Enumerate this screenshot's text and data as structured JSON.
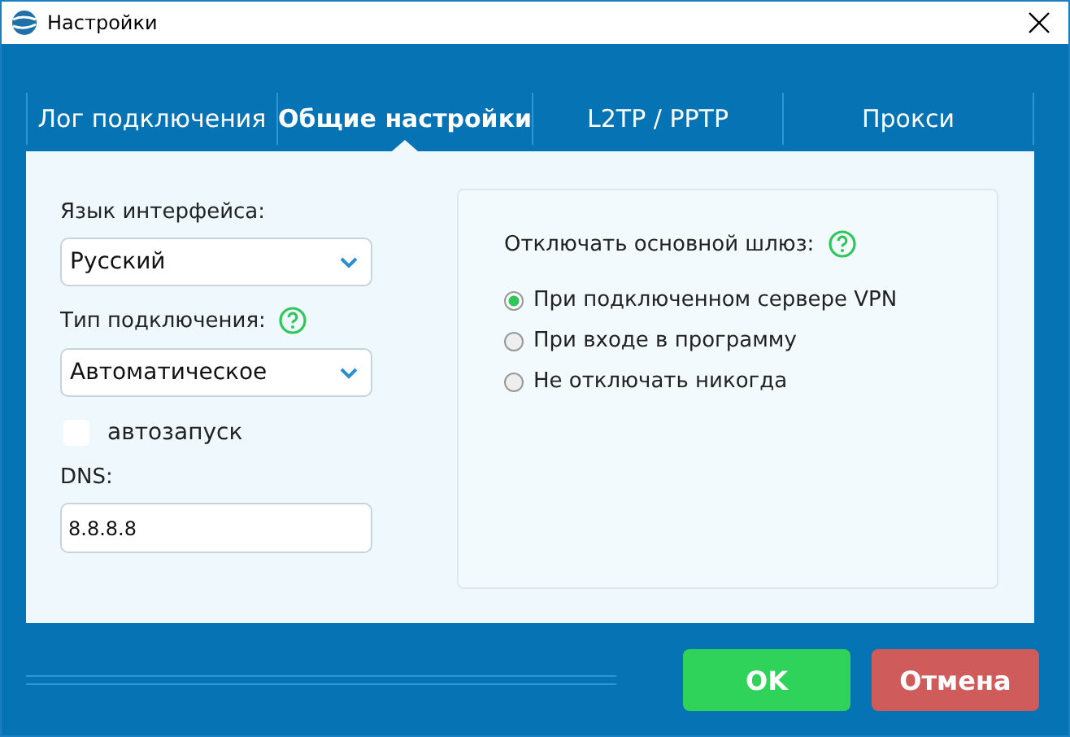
{
  "window": {
    "title": "Настройки"
  },
  "tabs": [
    {
      "label": "Лог подключения",
      "selected": false
    },
    {
      "label": "Общие настройки",
      "selected": true
    },
    {
      "label": "L2TP / PPTP",
      "selected": false
    },
    {
      "label": "Прокси",
      "selected": false
    }
  ],
  "left": {
    "language_label": "Язык интерфейса:",
    "language_value": "Русский",
    "type_label": "Тип подключения:",
    "type_value": "Автоматическое",
    "autostart": {
      "label": "автозапуск",
      "checked": false
    },
    "dns_label": "DNS:",
    "dns_value": "8.8.8.8"
  },
  "gateway": {
    "title": "Отключать основной шлюз:",
    "options": [
      {
        "label": "При подключенном сервере VPN",
        "selected": true
      },
      {
        "label": "При входе в программу",
        "selected": false
      },
      {
        "label": "Не отключать никогда",
        "selected": false
      }
    ]
  },
  "buttons": [
    {
      "label": "OK",
      "kind": "ok"
    },
    {
      "label": "Отмена",
      "kind": "cancel"
    }
  ]
}
